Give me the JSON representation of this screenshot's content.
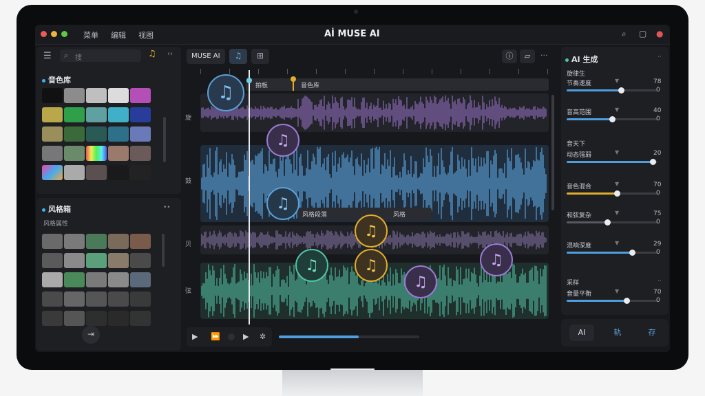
{
  "app": {
    "title": "MUSE AI",
    "logo_text": "Aİ"
  },
  "menu": [
    "菜单",
    "编辑",
    "视图"
  ],
  "colors": {
    "accent": "#3fb0f0",
    "gold": "#e2ad2c",
    "purple": "#9b7ad6",
    "teal": "#4fc4a8",
    "blue": "#5aa0d8"
  },
  "left": {
    "search_placeholder": "搜",
    "timbre_title": "音色库",
    "style_title": "风格箱",
    "style_subtitle": "风格属性"
  },
  "toolbar": {
    "label": "MUSE AI"
  },
  "timeline": {
    "marker_1": "拍板",
    "marker_2": "音色库",
    "region_1": "风格段落",
    "region_2": "风格"
  },
  "lanes": [
    {
      "label": "旋"
    },
    {
      "label": "鼓"
    },
    {
      "label": "贝"
    },
    {
      "label": "弦"
    }
  ],
  "transport": {
    "progress": 0.57
  },
  "right": {
    "title": "AI 生成",
    "sub_1": "旋律生",
    "sub_2": "音天下",
    "sub_3": "采样",
    "sliders": [
      {
        "label": "节奏速度",
        "top_value": "78",
        "bottom_value": "0",
        "level": 0.6,
        "color": "#4f9fe0"
      },
      {
        "label": "音高范围",
        "top_value": "40",
        "bottom_value": "0",
        "level": 0.5,
        "color": "#4f9fe0"
      },
      {
        "label": "动态强弱",
        "top_value": "20",
        "bottom_value": "",
        "level": 0.95,
        "color": "#4f9fe0"
      },
      {
        "label": "音色混合",
        "top_value": "70",
        "bottom_value": "0",
        "level": 0.55,
        "color": "#e2ad2c"
      },
      {
        "label": "和弦复杂",
        "top_value": "75",
        "bottom_value": "0",
        "level": 0.45,
        "color": "#555961"
      },
      {
        "label": "混响深度",
        "top_value": "29",
        "bottom_value": "0",
        "level": 0.72,
        "color": "#4f9fe0"
      },
      {
        "label": "音量平衡",
        "top_value": "70",
        "bottom_value": "0",
        "level": 0.66,
        "color": "#4f9fe0"
      }
    ],
    "bottom_tabs": [
      "AI",
      "轨",
      "存"
    ]
  }
}
